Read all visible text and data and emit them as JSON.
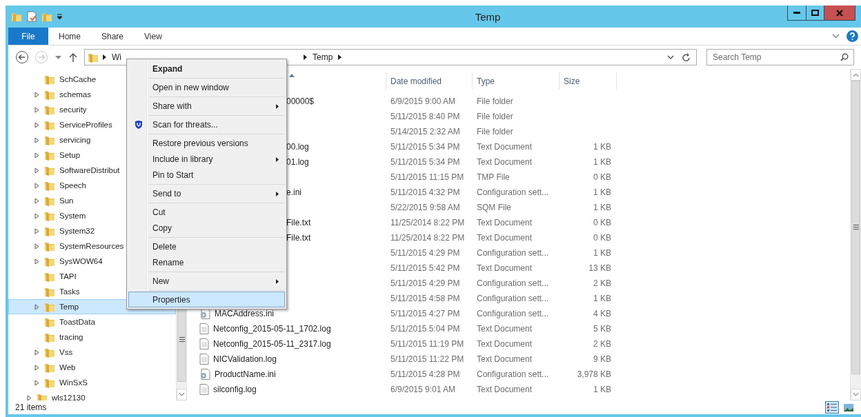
{
  "window": {
    "title": "Temp"
  },
  "ribbon_tabs": [
    {
      "label": "File",
      "kind": "file"
    },
    {
      "label": "Home",
      "kind": "tab"
    },
    {
      "label": "Share",
      "kind": "tab"
    },
    {
      "label": "View",
      "kind": "tab"
    }
  ],
  "address_bar": {
    "segments": [
      {
        "label": "Wi"
      },
      {
        "label": "Temp"
      }
    ]
  },
  "search": {
    "placeholder": "Search Temp"
  },
  "tree": {
    "items": [
      {
        "children": [
          {
            "label": "SchCache",
            "expandable": false,
            "selected": false
          },
          {
            "label": "schemas",
            "expandable": true,
            "selected": false
          },
          {
            "label": "security",
            "expandable": true,
            "selected": false
          },
          {
            "label": "ServiceProfiles",
            "expandable": true,
            "selected": false
          },
          {
            "label": "servicing",
            "expandable": true,
            "selected": false
          },
          {
            "label": "Setup",
            "expandable": true,
            "selected": false
          },
          {
            "label": "SoftwareDistribut",
            "expandable": true,
            "selected": false
          },
          {
            "label": "Speech",
            "expandable": true,
            "selected": false
          },
          {
            "label": "Sun",
            "expandable": true,
            "selected": false
          },
          {
            "label": "System",
            "expandable": true,
            "selected": false
          },
          {
            "label": "System32",
            "expandable": true,
            "selected": false
          },
          {
            "label": "SystemResources",
            "expandable": true,
            "selected": false
          },
          {
            "label": "SysWOW64",
            "expandable": true,
            "selected": false
          },
          {
            "label": "TAPI",
            "expandable": false,
            "selected": false
          },
          {
            "label": "Tasks",
            "expandable": false,
            "selected": false
          },
          {
            "label": "Temp",
            "expandable": true,
            "selected": true
          },
          {
            "label": "ToastData",
            "expandable": false,
            "selected": false
          },
          {
            "label": "tracing",
            "expandable": false,
            "selected": false
          },
          {
            "label": "Vss",
            "expandable": true,
            "selected": false
          },
          {
            "label": "Web",
            "expandable": true,
            "selected": false
          },
          {
            "label": "WinSxS",
            "expandable": true,
            "selected": false
          }
        ]
      },
      {
        "label": "wls12130",
        "expandable": true,
        "selected": false
      }
    ]
  },
  "file_list": {
    "columns": [
      {
        "label": "Date modified"
      },
      {
        "label": "Type"
      },
      {
        "label": "Size"
      }
    ],
    "rows": [
      {
        "name": "00000$",
        "date": "6/9/2015 9:00 AM",
        "type": "File folder"
      },
      {
        "date": "5/11/2015 8:40 PM",
        "type": "File folder"
      },
      {
        "date": "5/14/2015 2:32 AM",
        "type": "File folder"
      },
      {
        "name": "00.log",
        "date": "5/11/2015 5:34 PM",
        "type": "Text Document",
        "size": "1 KB"
      },
      {
        "name": "01.log",
        "date": "5/11/2015 5:34 PM",
        "type": "Text Document",
        "size": "1 KB"
      },
      {
        "date": "5/11/2015 11:15 PM",
        "type": "TMP File",
        "size": "0 KB"
      },
      {
        "name": "e.ini",
        "date": "5/11/2015 4:32 PM",
        "type": "Configuration sett...",
        "size": "1 KB"
      },
      {
        "date": "5/22/2015 9:58 AM",
        "type": "SQM File",
        "size": "1 KB"
      },
      {
        "name": "File.txt",
        "date": "11/25/2014 8:22 PM",
        "type": "Text Document",
        "size": "0 KB"
      },
      {
        "name": "File.txt",
        "date": "11/25/2014 8:22 PM",
        "type": "Text Document",
        "size": "0 KB"
      },
      {
        "date": "5/11/2015 4:29 PM",
        "type": "Configuration sett...",
        "size": "1 KB"
      },
      {
        "date": "5/11/2015 5:42 PM",
        "type": "Text Document",
        "size": "13 KB"
      },
      {
        "date": "5/11/2015 4:29 PM",
        "type": "Configuration sett...",
        "size": "2 KB"
      },
      {
        "date": "5/11/2015 4:58 PM",
        "type": "Configuration sett...",
        "size": "1 KB"
      },
      {
        "kind": "settings_file",
        "name": "MACAddress.ini",
        "date": "5/11/2015 4:27 PM",
        "type": "Configuration sett...",
        "size": "4 KB"
      },
      {
        "kind": "text_file",
        "name": "Netconfig_2015-05-11_1702.log",
        "date": "5/11/2015 5:04 PM",
        "type": "Text Document",
        "size": "5 KB"
      },
      {
        "kind": "text_file",
        "name": "Netconfig_2015-05-11_2317.log",
        "date": "5/11/2015 11:19 PM",
        "type": "Text Document",
        "size": "2 KB"
      },
      {
        "kind": "text_file",
        "name": "NICValidation.log",
        "date": "5/11/2015 11:22 PM",
        "type": "Text Document",
        "size": "9 KB"
      },
      {
        "kind": "settings_file",
        "name": "ProductName.ini",
        "date": "5/11/2015 4:28 PM",
        "type": "Configuration sett...",
        "size": "3,978 KB"
      },
      {
        "kind": "text_file",
        "name": "silconfig.log",
        "date": "6/9/2015 9:01 AM",
        "type": "Text Document",
        "size": "1 KB"
      }
    ]
  },
  "context_menu": {
    "items": [
      {
        "kind": "item",
        "label": "Expand",
        "default": true,
        "submenu": false,
        "selected": false
      },
      {
        "kind": "separator"
      },
      {
        "kind": "item",
        "label": "Open in new window",
        "default": false,
        "submenu": false,
        "selected": false
      },
      {
        "kind": "separator"
      },
      {
        "kind": "item",
        "label": "Share with",
        "default": false,
        "submenu": true,
        "selected": false
      },
      {
        "kind": "separator"
      },
      {
        "kind": "scan_item",
        "label": "Scan for threats...",
        "default": false,
        "submenu": false,
        "selected": false
      },
      {
        "kind": "separator"
      },
      {
        "kind": "item",
        "label": "Restore previous versions",
        "default": false,
        "submenu": false,
        "selected": false
      },
      {
        "kind": "item",
        "label": "Include in library",
        "default": false,
        "submenu": true,
        "selected": false
      },
      {
        "kind": "item",
        "label": "Pin to Start",
        "default": false,
        "submenu": false,
        "selected": false
      },
      {
        "kind": "separator"
      },
      {
        "kind": "item",
        "label": "Send to",
        "default": false,
        "submenu": true,
        "selected": false
      },
      {
        "kind": "separator"
      },
      {
        "kind": "item",
        "label": "Cut",
        "default": false,
        "submenu": false,
        "selected": false
      },
      {
        "kind": "item",
        "label": "Copy",
        "default": false,
        "submenu": false,
        "selected": false
      },
      {
        "kind": "separator"
      },
      {
        "kind": "item",
        "label": "Delete",
        "default": false,
        "submenu": false,
        "selected": false
      },
      {
        "kind": "item",
        "label": "Rename",
        "default": false,
        "submenu": false,
        "selected": false
      },
      {
        "kind": "separator"
      },
      {
        "kind": "item",
        "label": "New",
        "default": false,
        "submenu": true,
        "selected": false
      },
      {
        "kind": "separator"
      },
      {
        "kind": "item",
        "label": "Properties",
        "default": false,
        "submenu": false,
        "selected": true
      }
    ]
  },
  "status_bar": {
    "item_count": "21 items"
  }
}
